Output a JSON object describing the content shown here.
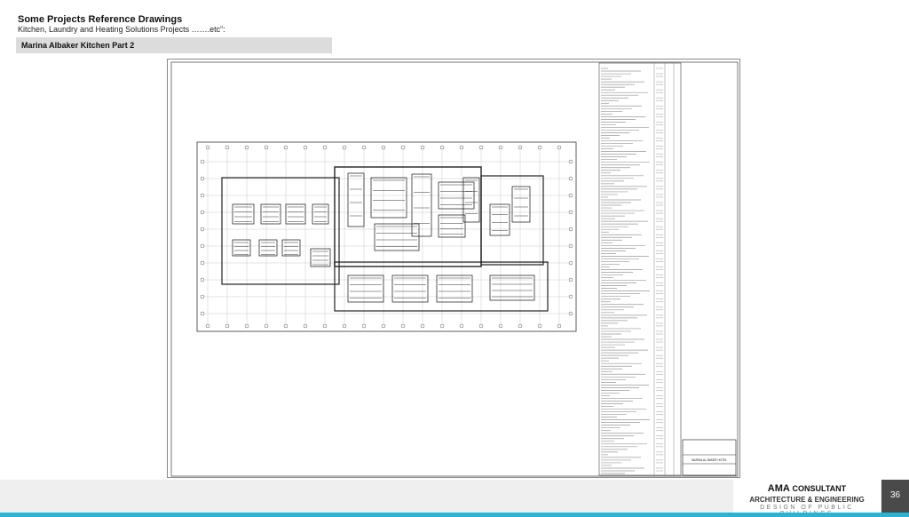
{
  "slide": {
    "title": "Some Projects Reference Drawings",
    "subtitle": "Kitchen, Laundry and Heating Solutions Projects …….etc”:",
    "section_label": "Marina Albaker Kitchen Part 2"
  },
  "drawing": {
    "title_block_project": "MARINA AL BAKER HOTEL"
  },
  "footer": {
    "brand_bold": "AMA",
    "brand_rest": "CONSULTANT",
    "tagline": "ARCHITECTURE & ENGINEERING",
    "subline": "DESIGN OF PUBLIC BUILDINGS",
    "page_number": "36"
  },
  "colors": {
    "accent": "#2bb3d6",
    "page_box": "#4a4a4a",
    "section_bar": "#dcdcdc"
  }
}
